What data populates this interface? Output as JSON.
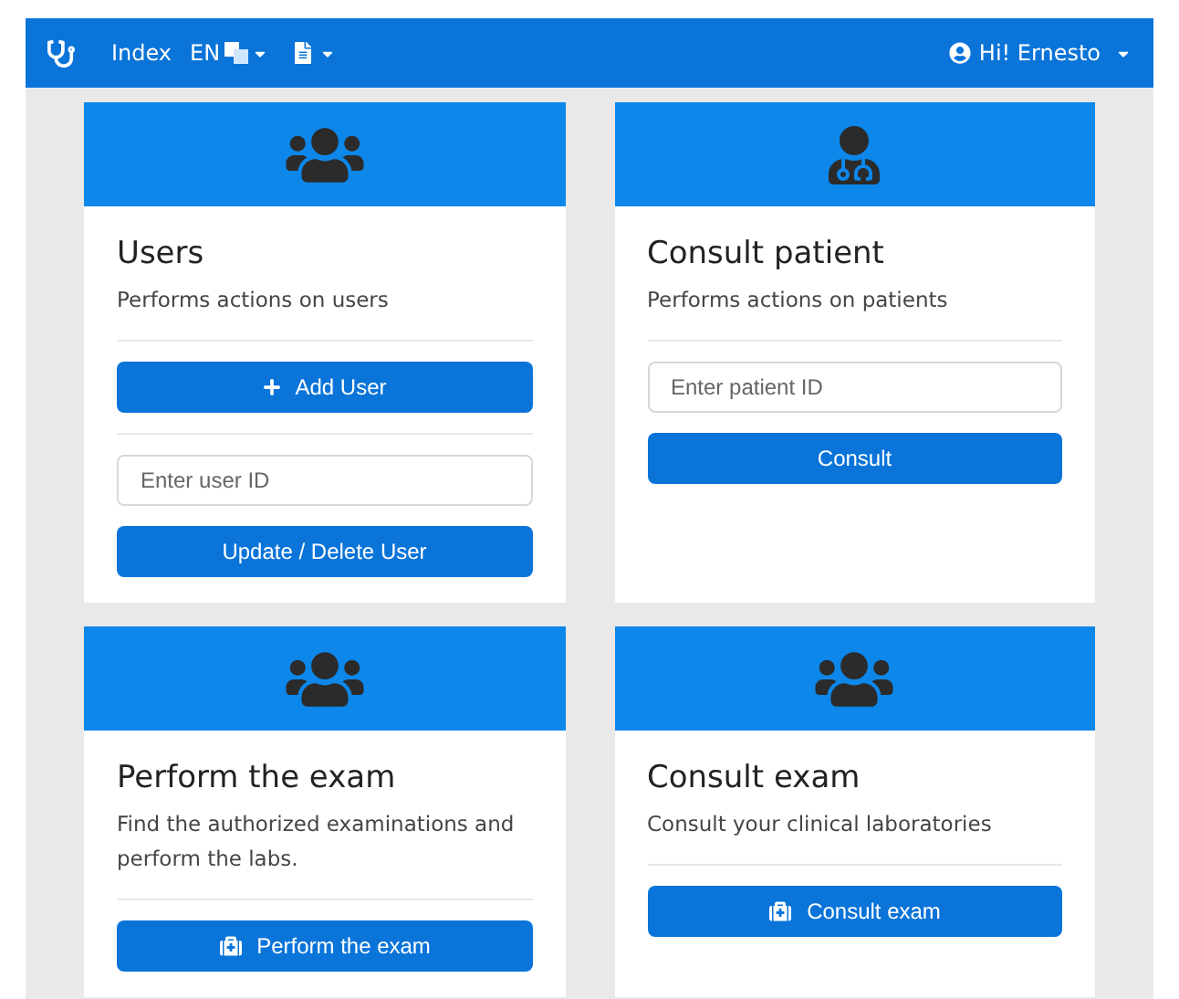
{
  "navbar": {
    "links": [
      {
        "kind": "index",
        "label": "Index"
      },
      {
        "kind": "language",
        "label": "EN"
      },
      {
        "kind": "document"
      }
    ],
    "user": {
      "label": "Hi! Ernesto"
    }
  },
  "cards": [
    {
      "kind": "team",
      "title": "Users",
      "description": "Performs actions on users",
      "items": [
        {
          "kind": "add",
          "label": "Add User"
        },
        {
          "kind": "divider"
        },
        {
          "kind": "field",
          "placeholder": "Enter user ID"
        },
        {
          "kind": "button",
          "label": "Update / Delete User"
        }
      ]
    },
    {
      "kind": "doctor",
      "title": "Consult patient",
      "description": "Performs actions on patients",
      "items": [
        {
          "kind": "field",
          "placeholder": "Enter patient ID"
        },
        {
          "kind": "button",
          "label": "Consult"
        }
      ]
    },
    {
      "kind": "team",
      "title": "Perform the exam",
      "description": "Find the authorized examinations and perform the labs.",
      "items": [
        {
          "kind": "kit",
          "label": "Perform the exam"
        }
      ]
    },
    {
      "kind": "team",
      "title": "Consult exam",
      "description": "Consult your clinical laboratories",
      "items": [
        {
          "kind": "kit",
          "label": "Consult exam"
        }
      ]
    }
  ]
}
